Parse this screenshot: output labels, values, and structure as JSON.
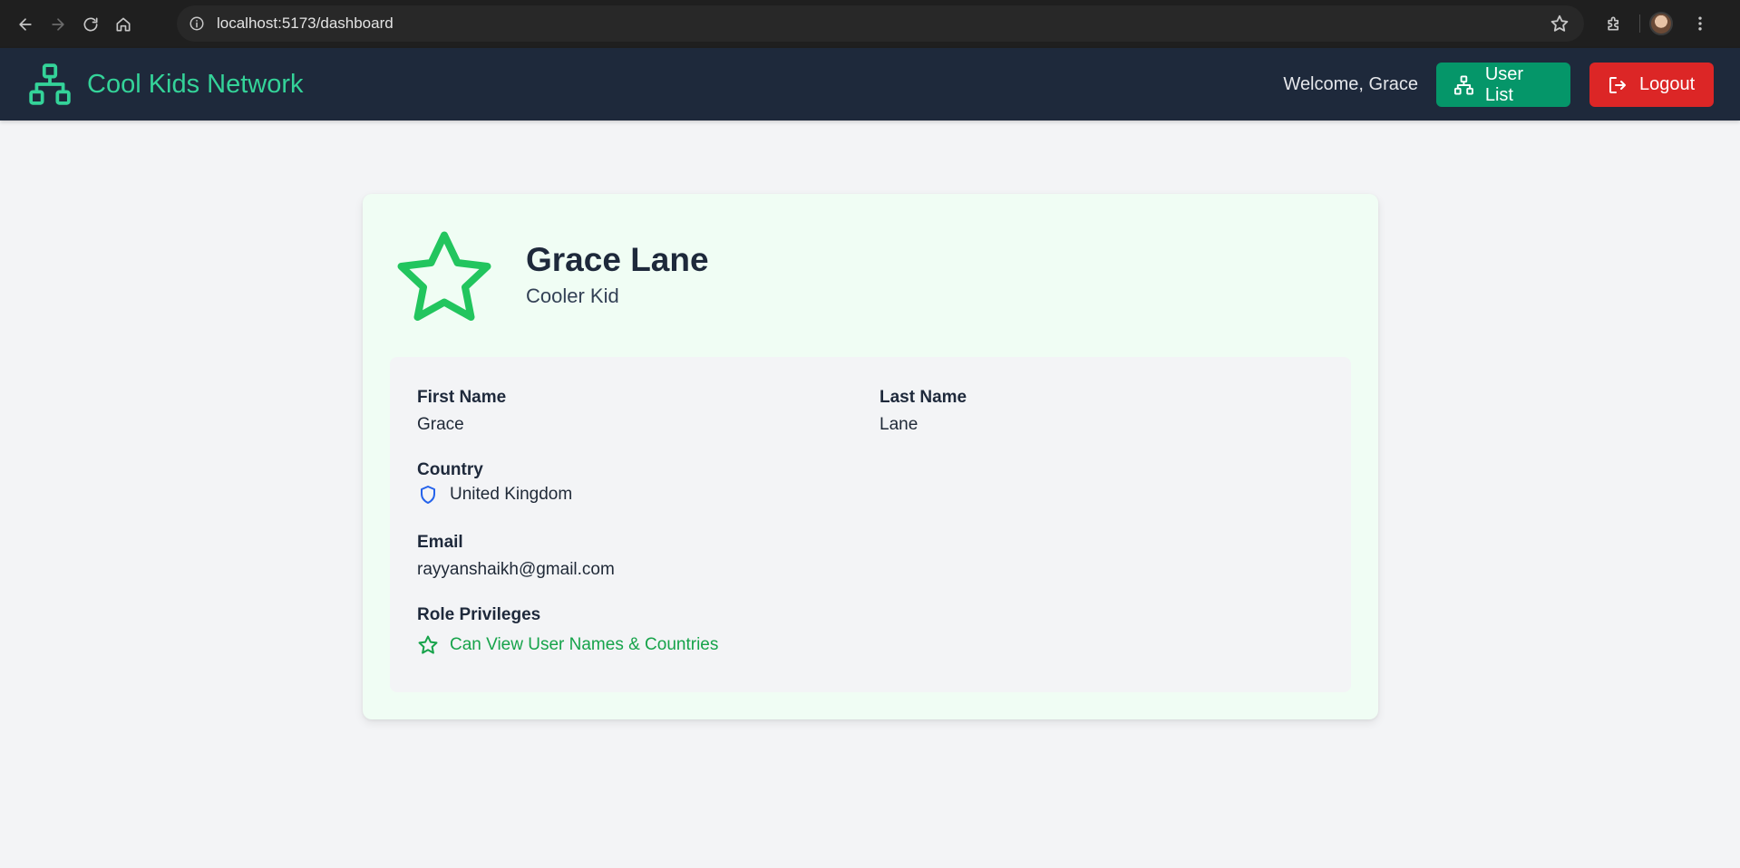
{
  "browser": {
    "url": "localhost:5173/dashboard",
    "icons": [
      "back-icon",
      "forward-icon",
      "reload-icon",
      "home-icon",
      "site-info-icon",
      "bookmark-star-icon",
      "extensions-icon",
      "profile-avatar",
      "more-menu-icon"
    ]
  },
  "header": {
    "title": "Cool Kids Network",
    "welcome": "Welcome, Grace",
    "user_list_label": "User List",
    "logout_label": "Logout",
    "colors": {
      "bg": "#1e293b",
      "brand": "#34d399",
      "user_list": "#059669",
      "logout": "#dc2626"
    }
  },
  "profile": {
    "name": "Grace Lane",
    "role": "Cooler Kid",
    "icon": "star-icon"
  },
  "details": {
    "first_name_label": "First Name",
    "first_name": "Grace",
    "last_name_label": "Last Name",
    "last_name": "Lane",
    "country_label": "Country",
    "country": "United Kingdom",
    "email_label": "Email",
    "email": "rayyanshaikh@gmail.com",
    "privileges_label": "Role Privileges",
    "privileges": [
      "Can View User Names & Countries"
    ]
  }
}
